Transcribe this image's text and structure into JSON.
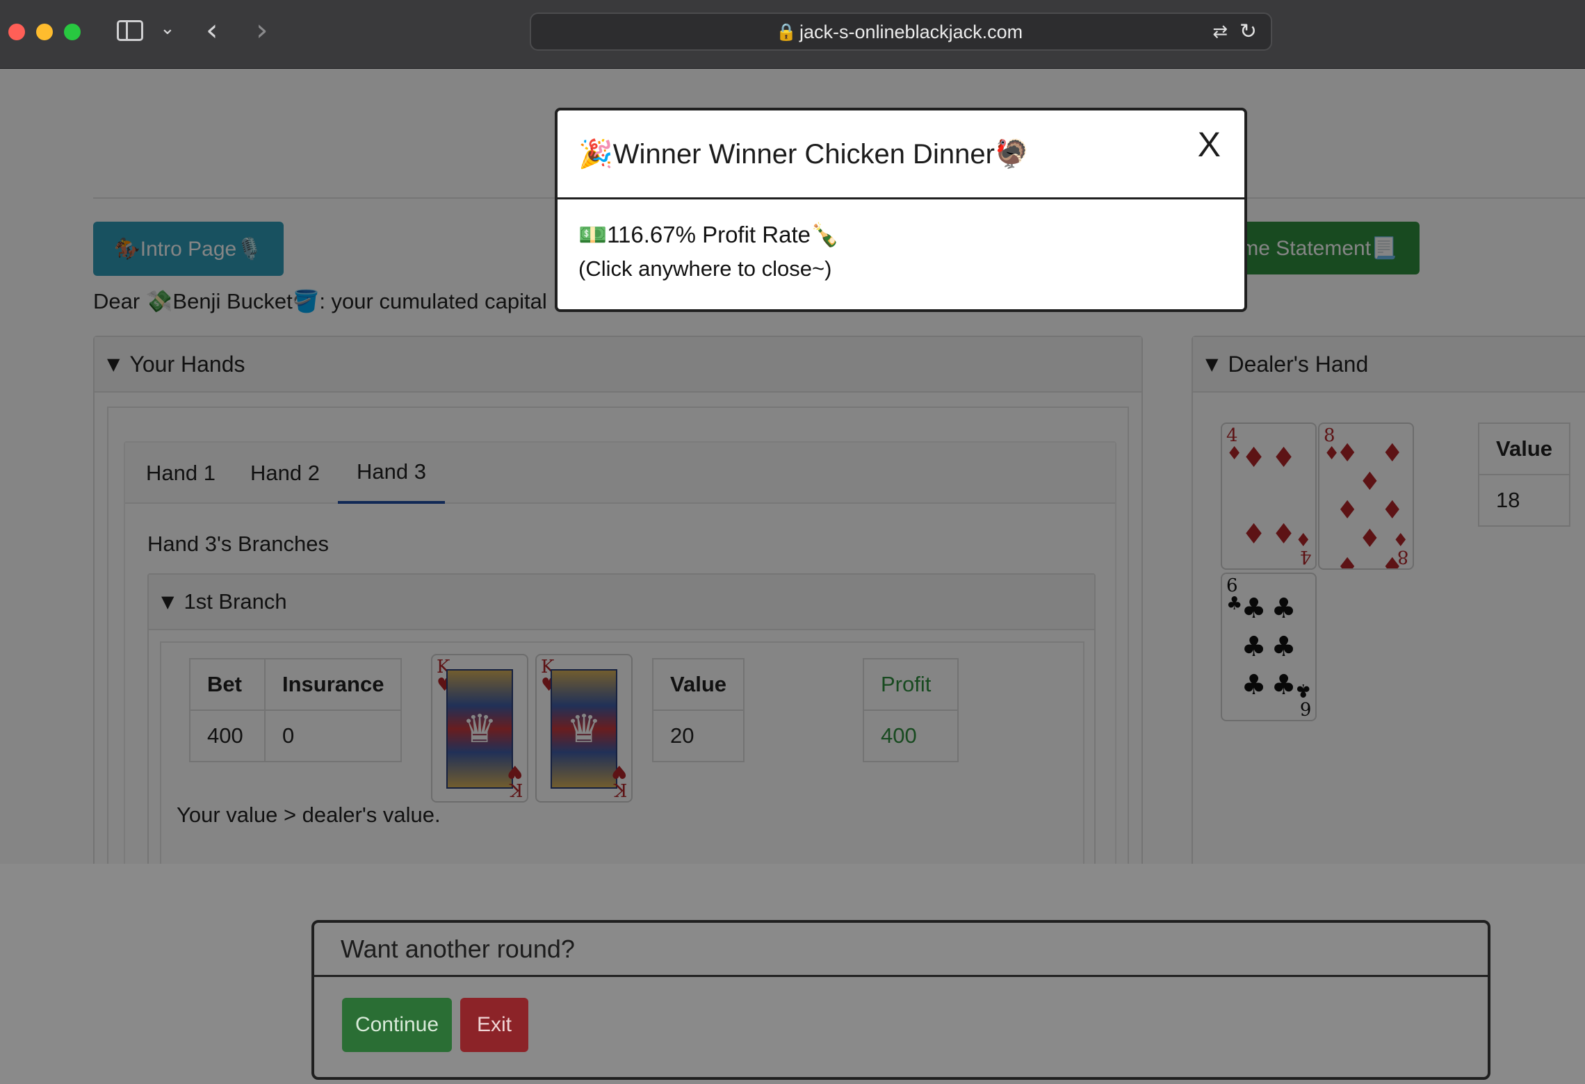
{
  "browser": {
    "url": "jack-s-onlineblackjack.com"
  },
  "header": {
    "intro_button": "🏇Intro Page🎙️",
    "income_button": "ome Statement📃",
    "greeting": "Dear 💸Benji Bucket🪣: your cumulated capital"
  },
  "your_hands": {
    "title": "Your Hands",
    "tabs": [
      "Hand 1",
      "Hand 2",
      "Hand 3"
    ],
    "active_tab": "Hand 3",
    "branches_title": "Hand 3's Branches",
    "branch": {
      "title": "1st Branch",
      "bet_header": "Bet",
      "insurance_header": "Insurance",
      "bet": "400",
      "insurance": "0",
      "cards": [
        {
          "rank": "K",
          "suit": "♥"
        },
        {
          "rank": "K",
          "suit": "♥"
        }
      ],
      "value_header": "Value",
      "value": "20",
      "profit_header": "Profit",
      "profit": "400",
      "result": "Your value > dealer's value."
    }
  },
  "dealer": {
    "title": "Dealer's Hand",
    "cards": [
      {
        "rank": "4",
        "suit": "♦"
      },
      {
        "rank": "8",
        "suit": "♦"
      },
      {
        "rank": "6",
        "suit": "♣"
      }
    ],
    "value_header": "Value",
    "value": "18"
  },
  "modal": {
    "title": "🎉Winner Winner Chicken Dinner🦃",
    "close": "X",
    "line1": "💵116.67% Profit Rate🍾",
    "line2": "(Click anywhere to close~)"
  },
  "prompt": {
    "title": "Want another round?",
    "continue": "Continue",
    "exit": "Exit"
  },
  "colors": {
    "intro_button": "#2f9bb8",
    "income_button": "#2e8f3e",
    "continue_button": "#2a6e34",
    "exit_button": "#8c2328",
    "profit_text": "#2e8f3e",
    "active_tab": "#1f4ea3"
  }
}
